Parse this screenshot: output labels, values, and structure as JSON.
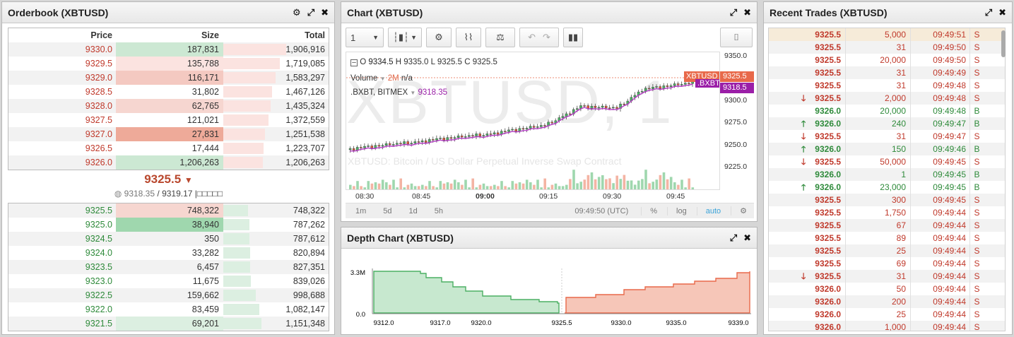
{
  "orderbook": {
    "title": "Orderbook (XBTUSD)",
    "headers": {
      "price": "Price",
      "size": "Size",
      "total": "Total"
    },
    "asks": [
      {
        "price": "9330.0",
        "size": "187,831",
        "total": "1,906,916",
        "sizeHl": "#cce8d3",
        "totalPct": 100
      },
      {
        "price": "9329.5",
        "size": "135,788",
        "total": "1,719,085",
        "sizeHl": "#fbe3e0",
        "totalPct": 90
      },
      {
        "price": "9329.0",
        "size": "116,171",
        "total": "1,583,297",
        "sizeHl": "#f4c9c1",
        "totalPct": 83
      },
      {
        "price": "9328.5",
        "size": "31,802",
        "total": "1,467,126",
        "sizeHl": "",
        "totalPct": 77
      },
      {
        "price": "9328.0",
        "size": "62,765",
        "total": "1,435,324",
        "sizeHl": "#f6d6d0",
        "totalPct": 75
      },
      {
        "price": "9327.5",
        "size": "121,021",
        "total": "1,372,559",
        "sizeHl": "",
        "totalPct": 72
      },
      {
        "price": "9327.0",
        "size": "27,831",
        "total": "1,251,538",
        "sizeHl": "#eeaa99",
        "totalPct": 66
      },
      {
        "price": "9326.5",
        "size": "17,444",
        "total": "1,223,707",
        "sizeHl": "",
        "totalPct": 64
      },
      {
        "price": "9326.0",
        "size": "1,206,263",
        "total": "1,206,263",
        "sizeHl": "#cce8d3",
        "totalPct": 63
      }
    ],
    "last_price": "9325.5",
    "index_price": "9318.35",
    "mark_price": "9319.17",
    "mid_suffix": "|□□□□□",
    "bids": [
      {
        "price": "9325.5",
        "size": "748,322",
        "total": "748,322",
        "sizeHl": "#f6d6d0",
        "totalPct": 39
      },
      {
        "price": "9325.0",
        "size": "38,940",
        "total": "787,262",
        "sizeHl": "#9fd7ae",
        "totalPct": 41
      },
      {
        "price": "9324.5",
        "size": "350",
        "total": "787,612",
        "sizeHl": "",
        "totalPct": 41
      },
      {
        "price": "9324.0",
        "size": "33,282",
        "total": "820,894",
        "sizeHl": "",
        "totalPct": 43
      },
      {
        "price": "9323.5",
        "size": "6,457",
        "total": "827,351",
        "sizeHl": "",
        "totalPct": 43
      },
      {
        "price": "9323.0",
        "size": "11,675",
        "total": "839,026",
        "sizeHl": "",
        "totalPct": 44
      },
      {
        "price": "9322.5",
        "size": "159,662",
        "total": "998,688",
        "sizeHl": "",
        "totalPct": 52
      },
      {
        "price": "9322.0",
        "size": "83,459",
        "total": "1,082,147",
        "sizeHl": "",
        "totalPct": 57
      },
      {
        "price": "9321.5",
        "size": "69,201",
        "total": "1,151,348",
        "sizeHl": "#dcefe1",
        "totalPct": 60
      }
    ]
  },
  "chart": {
    "title": "Chart (XBTUSD)",
    "interval": "1",
    "ohlc": {
      "o": "O",
      "o_val": "9334.5",
      "h": "H",
      "h_val": "9335.0",
      "l": "L",
      "l_val": "9325.5",
      "c": "C",
      "c_val": "9325.5"
    },
    "volume_label": "Volume",
    "volume_value": "2M",
    "volume_na": "n/a",
    "bxbt_label": ".BXBT, BITMEX",
    "bxbt_value": "9318.35",
    "watermark": "XBTUSD, 1",
    "subtitle": "XBTUSD: Bitcoin / US Dollar Perpetual Inverse Swap Contract",
    "price_tag": "9325.5",
    "price_tag_name": "XBTUSD",
    "bxbt_tag": "9318.5",
    "bxbt_tag_name": ".BXBT",
    "yticks": [
      "9350.0",
      "9325.0",
      "9300.0",
      "9275.0",
      "9250.0",
      "9225.0"
    ],
    "xticks": [
      "08:30",
      "08:45",
      "09:00",
      "09:15",
      "09:30",
      "09:45"
    ],
    "ranges": [
      "1m",
      "5d",
      "1d",
      "5h"
    ],
    "time": "09:49:50 (UTC)",
    "pct": "%",
    "log": "log",
    "auto": "auto"
  },
  "depth": {
    "title": "Depth Chart (XBTUSD)",
    "yticks": [
      "3.3M",
      "0.0"
    ],
    "xticks": [
      "9312.0",
      "9317.0",
      "9320.0",
      "9325.5",
      "9330.0",
      "9335.0",
      "9339.0"
    ]
  },
  "trades": {
    "title": "Recent Trades (XBTUSD)",
    "rows": [
      {
        "price": "9325.5",
        "size": "5,000",
        "time": "09:49:51",
        "side": "S",
        "dir": "",
        "hl": true
      },
      {
        "price": "9325.5",
        "size": "31",
        "time": "09:49:50",
        "side": "S",
        "dir": ""
      },
      {
        "price": "9325.5",
        "size": "20,000",
        "time": "09:49:50",
        "side": "S",
        "dir": ""
      },
      {
        "price": "9325.5",
        "size": "31",
        "time": "09:49:49",
        "side": "S",
        "dir": ""
      },
      {
        "price": "9325.5",
        "size": "31",
        "time": "09:49:48",
        "side": "S",
        "dir": ""
      },
      {
        "price": "9325.5",
        "size": "2,000",
        "time": "09:49:48",
        "side": "S",
        "dir": "down"
      },
      {
        "price": "9326.0",
        "size": "20,000",
        "time": "09:49:48",
        "side": "B",
        "dir": ""
      },
      {
        "price": "9326.0",
        "size": "240",
        "time": "09:49:47",
        "side": "B",
        "dir": "up"
      },
      {
        "price": "9325.5",
        "size": "31",
        "time": "09:49:47",
        "side": "S",
        "dir": "down"
      },
      {
        "price": "9326.0",
        "size": "150",
        "time": "09:49:46",
        "side": "B",
        "dir": "up"
      },
      {
        "price": "9325.5",
        "size": "50,000",
        "time": "09:49:45",
        "side": "S",
        "dir": "down"
      },
      {
        "price": "9326.0",
        "size": "1",
        "time": "09:49:45",
        "side": "B",
        "dir": ""
      },
      {
        "price": "9326.0",
        "size": "23,000",
        "time": "09:49:45",
        "side": "B",
        "dir": "up"
      },
      {
        "price": "9325.5",
        "size": "300",
        "time": "09:49:45",
        "side": "S",
        "dir": ""
      },
      {
        "price": "9325.5",
        "size": "1,750",
        "time": "09:49:44",
        "side": "S",
        "dir": ""
      },
      {
        "price": "9325.5",
        "size": "67",
        "time": "09:49:44",
        "side": "S",
        "dir": ""
      },
      {
        "price": "9325.5",
        "size": "89",
        "time": "09:49:44",
        "side": "S",
        "dir": ""
      },
      {
        "price": "9325.5",
        "size": "25",
        "time": "09:49:44",
        "side": "S",
        "dir": ""
      },
      {
        "price": "9325.5",
        "size": "69",
        "time": "09:49:44",
        "side": "S",
        "dir": ""
      },
      {
        "price": "9325.5",
        "size": "31",
        "time": "09:49:44",
        "side": "S",
        "dir": "down"
      },
      {
        "price": "9326.0",
        "size": "50",
        "time": "09:49:44",
        "side": "S",
        "dir": ""
      },
      {
        "price": "9326.0",
        "size": "200",
        "time": "09:49:44",
        "side": "S",
        "dir": ""
      },
      {
        "price": "9326.0",
        "size": "25",
        "time": "09:49:44",
        "side": "S",
        "dir": ""
      },
      {
        "price": "9326.0",
        "size": "1,000",
        "time": "09:49:44",
        "side": "S",
        "dir": ""
      }
    ]
  },
  "colors": {
    "sell": "#c0392b",
    "buy": "#2e8a3a",
    "bid_fill": "#9fd7ae",
    "ask_fill": "#f1a491"
  }
}
